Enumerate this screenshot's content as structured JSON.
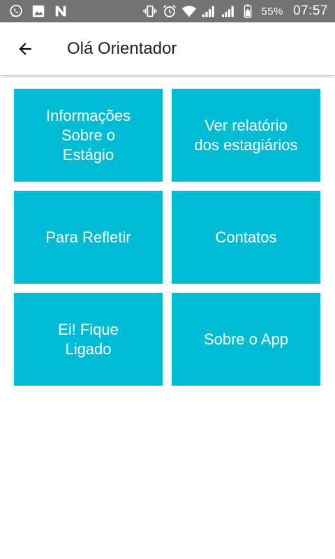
{
  "status_bar": {
    "left_icons": [
      "whatsapp-icon",
      "gallery-icon",
      "n-notification-icon"
    ],
    "right_icons": [
      "vibrate-icon",
      "alarm-icon",
      "wifi-icon",
      "signal-icon",
      "signal-icon",
      "battery-icon"
    ],
    "battery_percent": "55%",
    "time": "07:57"
  },
  "appbar": {
    "title": "Olá Orientador",
    "back_icon": "arrow-back-icon"
  },
  "menu": {
    "tiles": [
      {
        "label": "Informações Sobre o Estágio"
      },
      {
        "label": "Ver relatório dos estagiários"
      },
      {
        "label": "Para Refletir"
      },
      {
        "label": "Contatos"
      },
      {
        "label": "Ei! Fique Ligado"
      },
      {
        "label": "Sobre o App"
      }
    ]
  },
  "colors": {
    "status_bar": "#737373",
    "tile": "#00bcd4",
    "tile_text": "#ffffff",
    "title_text": "#212121"
  }
}
